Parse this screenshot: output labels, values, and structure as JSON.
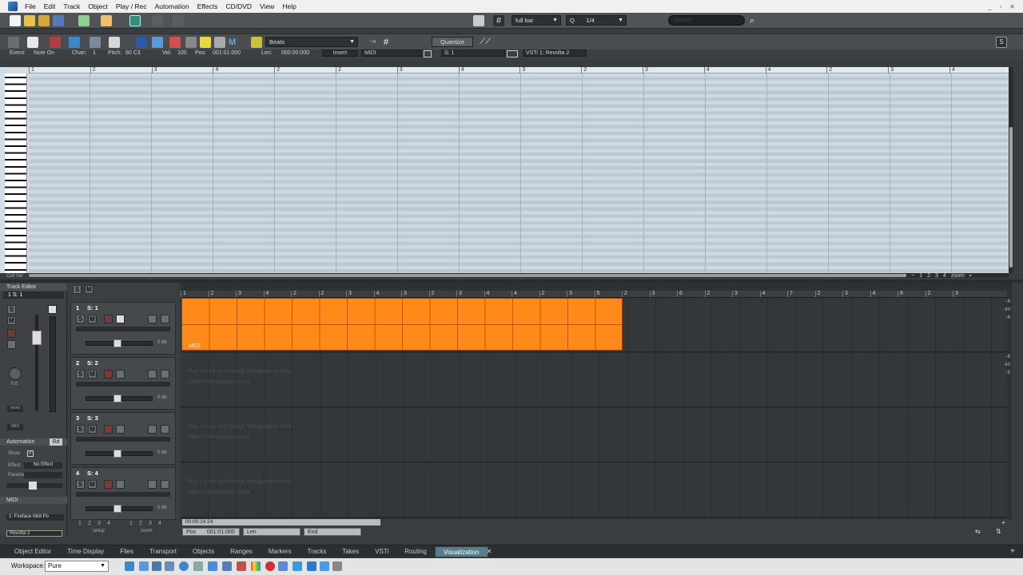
{
  "menu": [
    "File",
    "Edit",
    "Track",
    "Object",
    "Play / Rec",
    "Automation",
    "Effects",
    "CD/DVD",
    "View",
    "Help"
  ],
  "window_buttons": [
    "_",
    "▫",
    "✕"
  ],
  "toolbar": {
    "grid_value": "full bar",
    "q_label": "Q",
    "quant_value": "1/4",
    "search_placeholder": "Search",
    "beats_label": "Beats",
    "quantize_label": "Quantize"
  },
  "infobar": {
    "event_label": "Event:",
    "event_value": "Note On",
    "chan_label": "Chan:",
    "chan_value": "1",
    "pitch_label": "Pitch:",
    "pitch_value": "60 C3",
    "vel_label": "Vel:",
    "vel_value": "100",
    "pos_label": "Pos:",
    "pos_value": "001:01:000",
    "len_label": "Len:",
    "len_value": "000:00:000",
    "insert_label": "Insert",
    "midi_label": "MIDI",
    "s1_label": "S: 1",
    "vsti_label": "VSTi 1: Revolta 2"
  },
  "piano_ruler": [
    "1",
    "2",
    "3",
    "4",
    "2",
    "2",
    "3",
    "4",
    "3",
    "2",
    "3",
    "4",
    "4",
    "2",
    "3",
    "4"
  ],
  "zoom": {
    "nums": [
      "1",
      "2",
      "3",
      "4"
    ],
    "label": "zoom"
  },
  "cell_vel_label": "Cell Vel",
  "track_editor": {
    "title": "Track Editor",
    "track_sel": "1  S: 1",
    "solo": "S",
    "mute": "M",
    "volume": "0.0",
    "mono_label": "mono",
    "midi_btn": "MIDI",
    "automation_title": "Automation",
    "rd": "Rd",
    "show_label": "Show",
    "effect_label": "Effect",
    "effect_value": "No Effect",
    "param_label": "Paramet.",
    "midi_section": "MIDI",
    "midi_in": "1: Fireface Midi Po",
    "midi_out": "Revolta 2"
  },
  "track_list_header": {
    "solo": "S",
    "mute": "M"
  },
  "tracks": [
    {
      "num": "1",
      "name": "S: 1",
      "vol": "0 db"
    },
    {
      "num": "2",
      "name": "S: 2",
      "vol": "0 db"
    },
    {
      "num": "3",
      "name": "S: 3",
      "vol": "0 db"
    },
    {
      "num": "4",
      "name": "S: 4",
      "vol": "0 db"
    }
  ],
  "track_buttons": {
    "solo": "S",
    "mute": "M"
  },
  "arr_ruler": [
    "1",
    "2",
    "3",
    "4",
    "2",
    "2",
    "3",
    "4",
    "3",
    "2",
    "3",
    "4",
    "4",
    "2",
    "3",
    "5",
    "2",
    "3",
    "6",
    "2",
    "3",
    "4",
    "7",
    "2",
    "3",
    "4",
    "8",
    "2",
    "3"
  ],
  "lane_hints": [
    "Play Cursor and Range Manipulation Area",
    "Object Manipulation Area"
  ],
  "midi_clip_label": "MIDI",
  "meter_labels": [
    "-6",
    "-inf",
    "-6",
    "-6",
    "-inf",
    "-5"
  ],
  "position": {
    "time": "00:00:14:24",
    "pos_label": "Pos",
    "pos_value": "001:01:000",
    "len_label": "Len",
    "end_label": "End"
  },
  "bottom_left": {
    "setup_label": "setup",
    "zoom_label": "zoom",
    "nums": [
      "1",
      "2",
      "3",
      "4"
    ]
  },
  "tabs": [
    "Object Editor",
    "Time Display",
    "Files",
    "Transport",
    "Objects",
    "Ranges",
    "Markers",
    "Tracks",
    "Takes",
    "VSTi",
    "Routing"
  ],
  "active_tab": "Visualization",
  "workspace": {
    "label": "Workspace:",
    "value": "Pure"
  },
  "colors": {
    "clip": "#ff8a1a",
    "accent_tab": "#5a7c86"
  }
}
